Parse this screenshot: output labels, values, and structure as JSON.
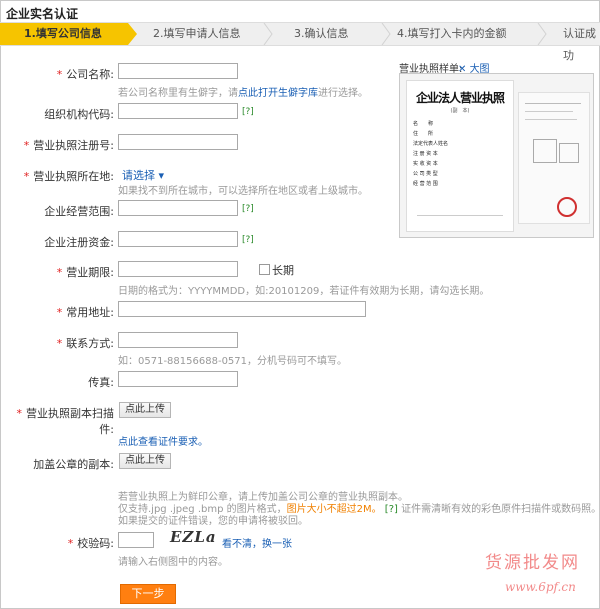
{
  "page_title": "企业实名认证",
  "steps": [
    "1.填写公司信息",
    "2.填写申请人信息",
    "3.确认信息",
    "4.填写打入卡内的金额",
    "认证成功"
  ],
  "accent_color": "#f6c400",
  "form": {
    "company_name": {
      "label": "公司名称:",
      "hint_pre": "若公司名称里有生僻字，请",
      "hint_link": "点此打开生僻字库",
      "hint_post": "进行选择。"
    },
    "org_code": {
      "label": "组织机构代码:",
      "help": "[?]"
    },
    "license_no": {
      "label": "营业执照注册号:"
    },
    "license_location": {
      "label": "营业执照所在地:",
      "select_text": "请选择 ▾",
      "hint": "如果找不到所在城市，可以选择所在地区或者上级城市。"
    },
    "business_scope": {
      "label": "企业经营范围:",
      "help": "[?]"
    },
    "registered_capital": {
      "label": "企业注册资金:",
      "help": "[?]"
    },
    "business_period": {
      "label": "营业期限:",
      "long_term": "长期",
      "hint": "日期的格式为：YYYYMMDD，如:20101209，若证件有效期为长期，请勾选长期。"
    },
    "address": {
      "label": "常用地址:"
    },
    "contact": {
      "label": "联系方式:",
      "hint": "如：0571-88156688-0571，分机号码可不填写。"
    },
    "fax": {
      "label": "传真:"
    },
    "license_scan": {
      "label": "营业执照副本扫描件:",
      "button": "点此上传",
      "link": "点此查看证件要求。"
    },
    "seal_copy": {
      "label": "加盖公章的副本:",
      "button": "点此上传",
      "hint1": "若营业执照上为鲜印公章，请上传加盖公司公章的营业执照副本。",
      "hint2a": "仅支持.jpg .jpeg .bmp 的图片格式，",
      "hint2b": "图片大小不超过2M。",
      "hint2c": "[?]",
      "hint2d": "证件需清晰有效的彩色原件扫描件或数码照。",
      "hint3": "如果提交的证件错误，您的申请将被驳回。"
    },
    "captcha": {
      "label": "校验码:",
      "image_text": "EZLa",
      "refresh": "看不清，换一张",
      "hint": "请输入右侧图中的内容。"
    },
    "submit": "下一步"
  },
  "sample": {
    "label": "营业执照样单:",
    "zoom": "大图",
    "doc_title": "企业法人营业执照",
    "doc_sub": "(副　本)",
    "fields": [
      "名　　称",
      "住　　所",
      "法定代表人姓名",
      "注 册 资 本",
      "实 收 资 本",
      "公 司 类 型",
      "经 营 范 围"
    ]
  },
  "watermark": {
    "text": "货源批发网",
    "url": "www.6pf.cn"
  }
}
